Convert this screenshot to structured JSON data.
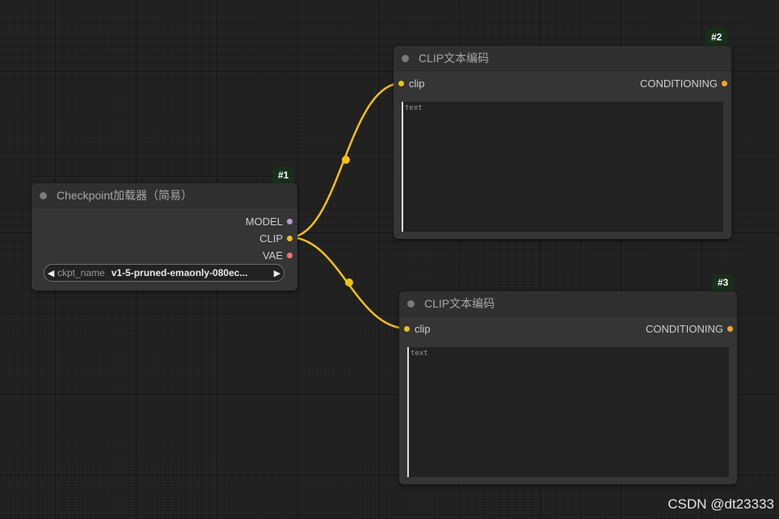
{
  "colors": {
    "link": "#F4C20D",
    "clip_slot": "#F4C20D",
    "conditioning_slot": "#F5A623",
    "model_slot": "#B39DDB",
    "vae_slot": "#FF6E6E",
    "badge_bg": "#16301C"
  },
  "nodes": {
    "checkpoint": {
      "badge": "#1",
      "title": "Checkpoint加载器（简易）",
      "outputs": [
        "MODEL",
        "CLIP",
        "VAE"
      ],
      "widget": {
        "name": "ckpt_name",
        "value": "v1-5-pruned-emaonly-080ec..."
      }
    },
    "clip_encode_2": {
      "badge": "#2",
      "title": "CLIP文本编码",
      "input": "clip",
      "output": "CONDITIONING",
      "text_placeholder": "text"
    },
    "clip_encode_3": {
      "badge": "#3",
      "title": "CLIP文本编码",
      "input": "clip",
      "output": "CONDITIONING",
      "text_placeholder": "text"
    }
  },
  "watermark": "CSDN @dt23333"
}
